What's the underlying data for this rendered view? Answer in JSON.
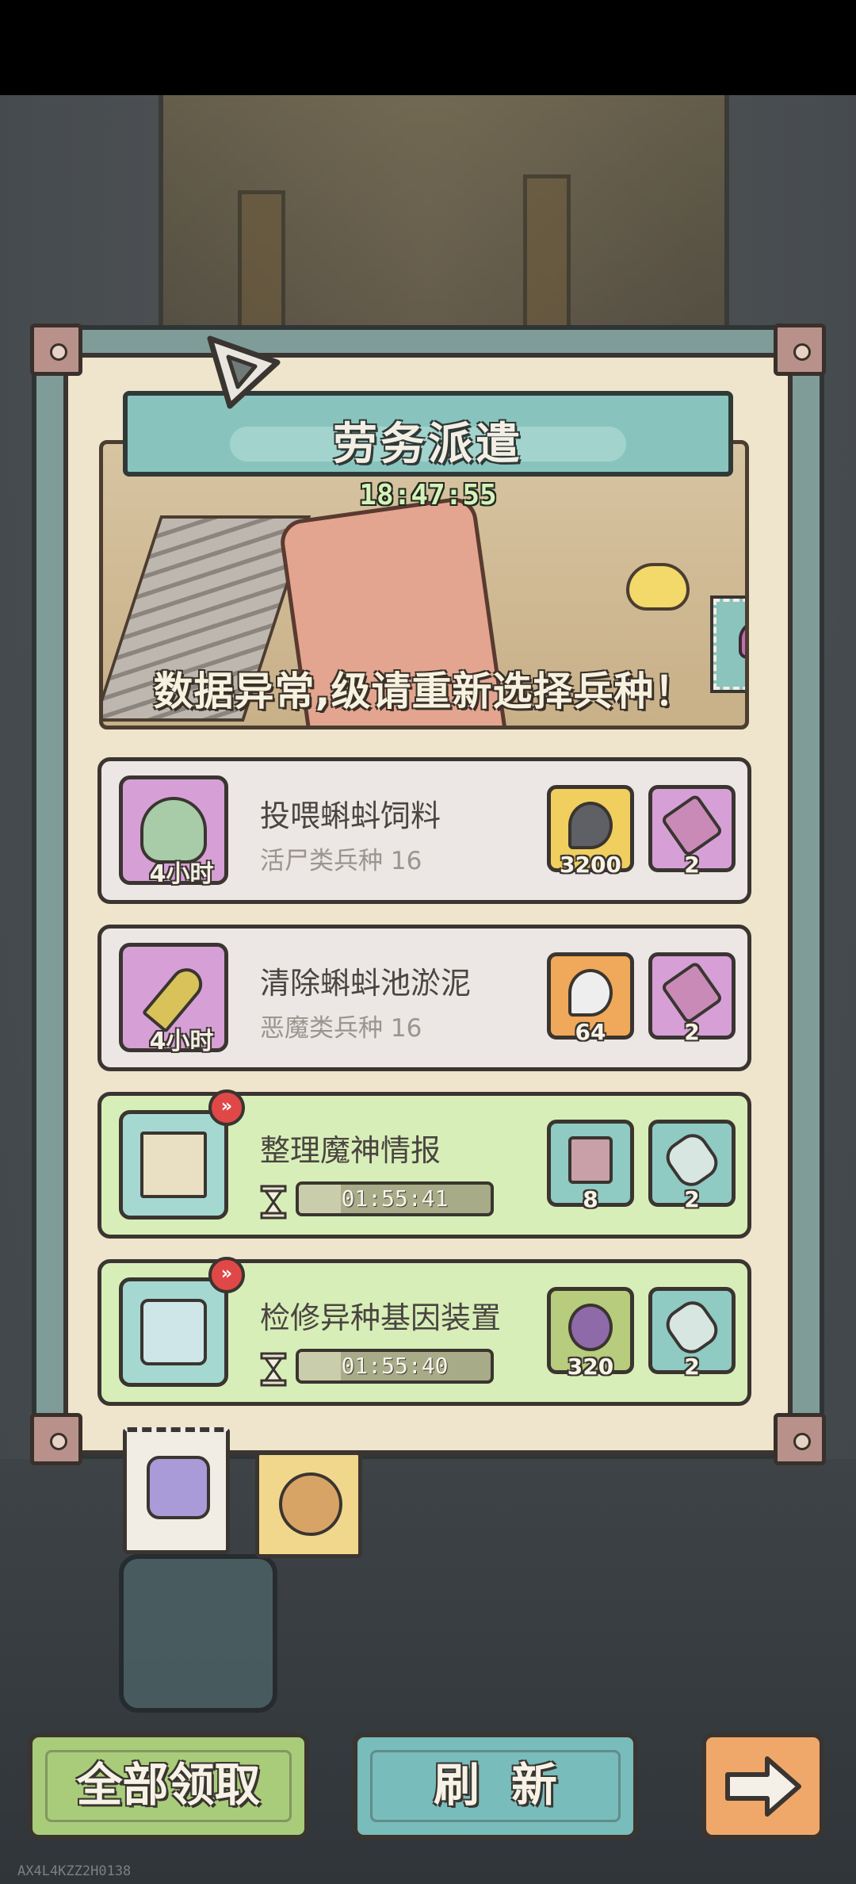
{
  "header": {
    "title": "劳务派遣",
    "countdown": "18:47:55",
    "notice": "数据异常,级请重新选择兵种！"
  },
  "tasks": [
    {
      "name": "投喂蝌蚪饲料",
      "requirement": "活尸类兵种  16",
      "duration": "4小时",
      "state": "pending",
      "rewards": [
        {
          "icon": "gray-tadpole-icon",
          "qty": "3200"
        },
        {
          "icon": "cannon-icon",
          "qty": "2"
        }
      ]
    },
    {
      "name": "清除蝌蚪池淤泥",
      "requirement": "恶魔类兵种  16",
      "duration": "4小时",
      "state": "pending",
      "rewards": [
        {
          "icon": "white-tadpole-icon",
          "qty": "64"
        },
        {
          "icon": "cannon-icon",
          "qty": "2"
        }
      ]
    },
    {
      "name": "整理魔神情报",
      "timer": "01:55:41",
      "state": "in-progress",
      "rewards": [
        {
          "icon": "card-pack-icon",
          "qty": "8"
        },
        {
          "icon": "scroll-icon",
          "qty": "2"
        }
      ]
    },
    {
      "name": "检修异种基因装置",
      "timer": "01:55:40",
      "state": "in-progress",
      "rewards": [
        {
          "icon": "virus-icon",
          "qty": "320"
        },
        {
          "icon": "scroll-icon",
          "qty": "2"
        }
      ]
    }
  ],
  "buttons": {
    "claim_all": "全部领取",
    "refresh": "刷新"
  },
  "footer": {
    "build_id": "AX4L4KZZ2H0138"
  },
  "colors": {
    "panel_bg": "#efe4cc",
    "banner": "#88c4bd",
    "active_row": "#d8eeb8",
    "pending_row": "#ece7e5",
    "claim_button": "#a9cc7a",
    "refresh_button": "#78bcbb",
    "next_button": "#f0a86a"
  }
}
